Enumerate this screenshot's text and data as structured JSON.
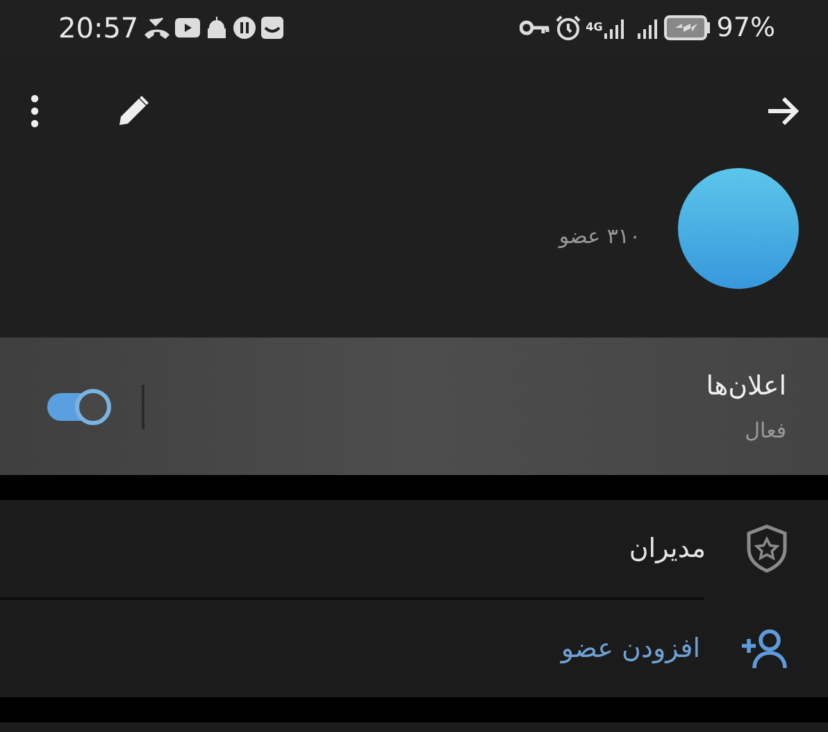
{
  "status_bar": {
    "time": "20:57",
    "network": "4G",
    "battery": "97%"
  },
  "header": {
    "member_count": "۳۱۰ عضو"
  },
  "notifications": {
    "title": "اعلان‌ها",
    "subtitle": "فعال",
    "on": true
  },
  "menu": [
    {
      "kind": "admins",
      "label": "مدیران"
    },
    {
      "kind": "add_member",
      "label": "افزودن عضو"
    }
  ]
}
